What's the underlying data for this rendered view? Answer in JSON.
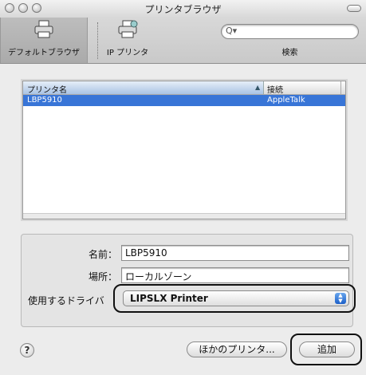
{
  "window": {
    "title": "プリンタブラウザ"
  },
  "toolbar": {
    "default_browser_label": "デフォルトブラウザ",
    "ip_printer_label": "IP プリンタ",
    "search_label": "検索",
    "search_placeholder": "Q▾"
  },
  "list": {
    "columns": [
      {
        "label": "プリンタ名"
      },
      {
        "label": "接続"
      }
    ],
    "rows": [
      {
        "name": "LBP5910",
        "connection": "AppleTalk",
        "selected": true
      }
    ]
  },
  "form": {
    "name_label": "名前：",
    "name_value": "LBP5910",
    "location_label": "場所：",
    "location_value": "ローカルゾーン",
    "driver_label": "使用するドライバ",
    "driver_value": "LIPSLX Printer"
  },
  "buttons": {
    "help": "?",
    "other_printers": "ほかのプリンタ...",
    "add": "追加"
  },
  "colors": {
    "selection": "#3875d7",
    "popup_arrow": "#1b5fc8"
  }
}
